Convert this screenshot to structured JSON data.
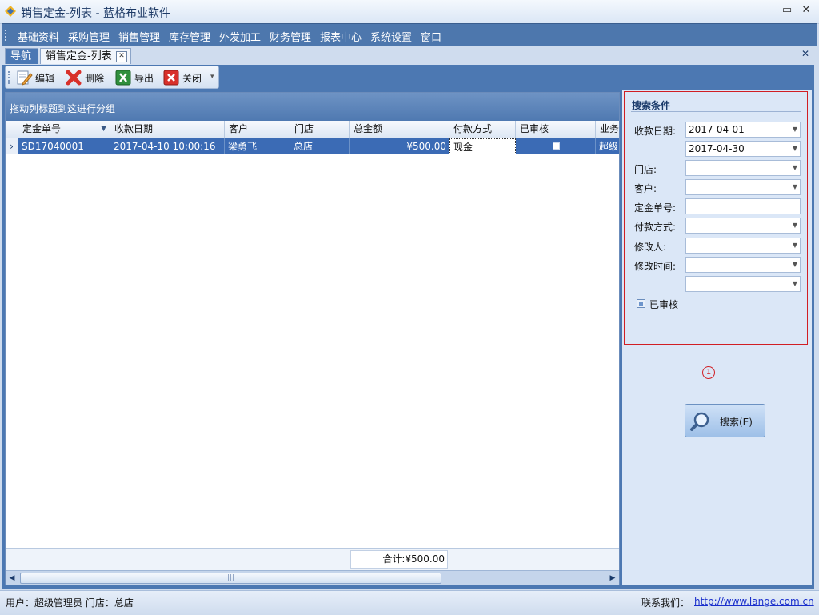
{
  "window": {
    "title": "销售定金-列表 - 蓝格布业软件",
    "minimize": "–",
    "restore": "▭",
    "close": "✕"
  },
  "menu": [
    "基础资料",
    "采购管理",
    "销售管理",
    "库存管理",
    "外发加工",
    "财务管理",
    "报表中心",
    "系统设置",
    "窗口"
  ],
  "tabs": {
    "nav_label": "导航",
    "active_label": "销售定金-列表",
    "close_glyph": "✕",
    "strip_close": "✕"
  },
  "toolbar": {
    "edit": "编辑",
    "delete": "删除",
    "export": "导出",
    "close": "关闭",
    "dropdown": "▾"
  },
  "grid": {
    "group_hint": "拖动列标题到这进行分组",
    "sort_glyph": "▼",
    "columns": [
      "定金单号",
      "收款日期",
      "客户",
      "门店",
      "总金额",
      "付款方式",
      "已审核",
      "业务"
    ],
    "rows": [
      {
        "indicator": "›",
        "order_no": "SD17040001",
        "date": "2017-04-10 10:00:16",
        "customer": "梁勇飞",
        "store": "总店",
        "amount": "¥500.00",
        "payment": "现金",
        "approved": "",
        "business": "超级"
      }
    ],
    "total": "合计:¥500.00",
    "scroll_left": "◀",
    "scroll_right": "▶",
    "scroll_grip": "|||"
  },
  "search": {
    "title": "搜索条件",
    "date_label": "收款日期:",
    "date_from": "2017-04-01",
    "date_to": "2017-04-30",
    "store_label": "门店:",
    "customer_label": "客户:",
    "order_no_label": "定金单号:",
    "payment_label": "付款方式:",
    "modifier_label": "修改人:",
    "modify_time_label": "修改时间:",
    "approved_label": "已审核",
    "marker": "1",
    "button_label": "搜索(E)"
  },
  "status": {
    "user": "用户：超级管理员  门店：总店",
    "contact_label": "联系我们：",
    "link": "http://www.lange.com.cn"
  },
  "colors": {
    "menu_bg": "#4d77ad",
    "selection": "#3b6bb5",
    "highlight_border": "#d11e24",
    "link": "#1a2fcc"
  }
}
